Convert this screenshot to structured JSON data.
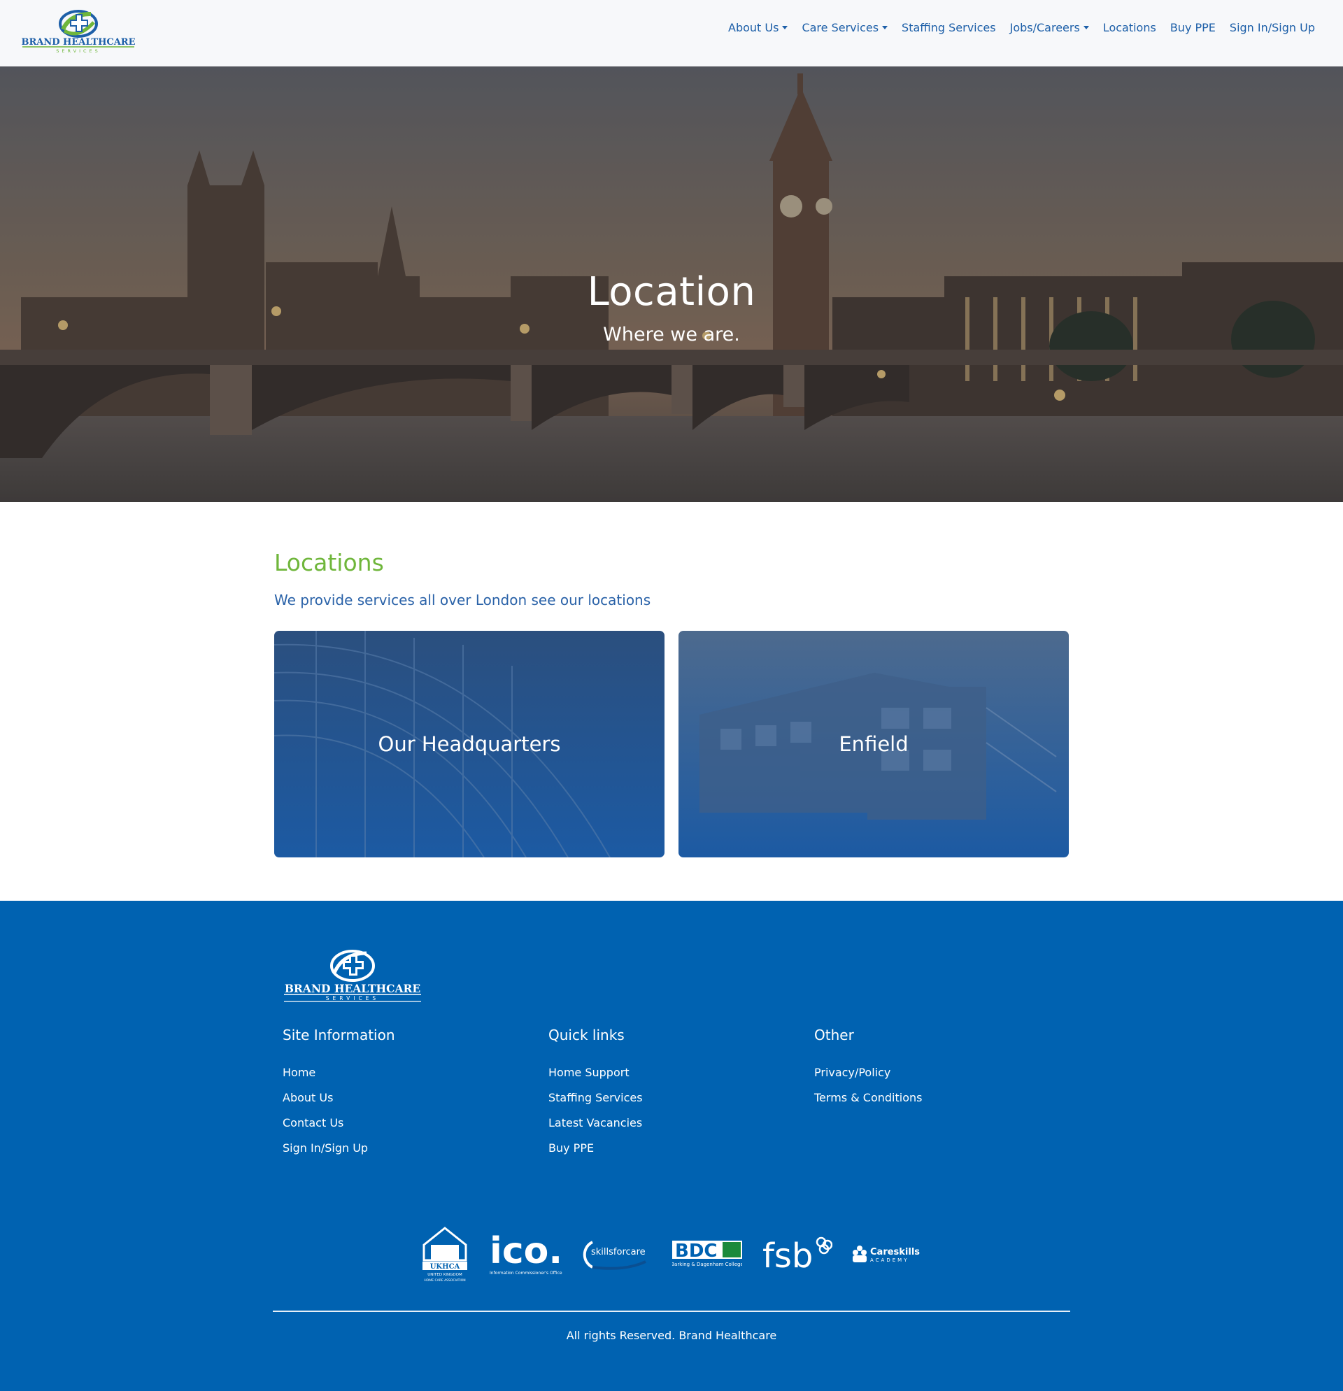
{
  "brand": {
    "name": "BRAND HEALTHCARE",
    "tagline": "SERVICES"
  },
  "nav": {
    "items": [
      {
        "label": "About Us",
        "dropdown": true
      },
      {
        "label": "Care Services",
        "dropdown": true
      },
      {
        "label": "Staffing Services",
        "dropdown": false
      },
      {
        "label": "Jobs/Careers",
        "dropdown": true
      },
      {
        "label": "Locations",
        "dropdown": false
      },
      {
        "label": "Buy PPE",
        "dropdown": false
      },
      {
        "label": "Sign In/Sign Up",
        "dropdown": false
      }
    ]
  },
  "hero": {
    "title": "Location",
    "subtitle": "Where we are."
  },
  "locations": {
    "title": "Locations",
    "subtitle": "We provide services all over London see our locations",
    "cards": [
      {
        "label": "Our Headquarters"
      },
      {
        "label": "Enfield"
      }
    ]
  },
  "footer": {
    "columns": [
      {
        "title": "Site Information",
        "links": [
          "Home",
          "About Us",
          "Contact Us",
          "Sign In/Sign Up"
        ]
      },
      {
        "title": "Quick links",
        "links": [
          "Home Support",
          "Staffing Services",
          "Latest Vacancies",
          "Buy PPE"
        ]
      },
      {
        "title": "Other",
        "links": [
          "Privacy/Policy",
          "Terms & Conditions"
        ]
      }
    ],
    "partners": {
      "ukhca": {
        "name": "UKHCA",
        "line1": "UNITED KINGDOM",
        "line2": "HOME CARE ASSOCIATION"
      },
      "ico": {
        "name": "ico.",
        "caption": "Information Commissioner's Office"
      },
      "skills": {
        "name": "skillsforcare"
      },
      "bdc": {
        "name": "BDC",
        "caption": "Barking & Dagenham College"
      },
      "fsb": {
        "name": "fsb"
      },
      "careskills": {
        "name": "Careskills",
        "caption": "ACADEMY"
      }
    },
    "copyright": "All rights Reserved. Brand Healthcare"
  },
  "colors": {
    "brand_green": "#6fb63b",
    "brand_blue": "#1d5fa8",
    "footer_blue": "#0062b1",
    "card_overlay": "#1f5aa0"
  }
}
